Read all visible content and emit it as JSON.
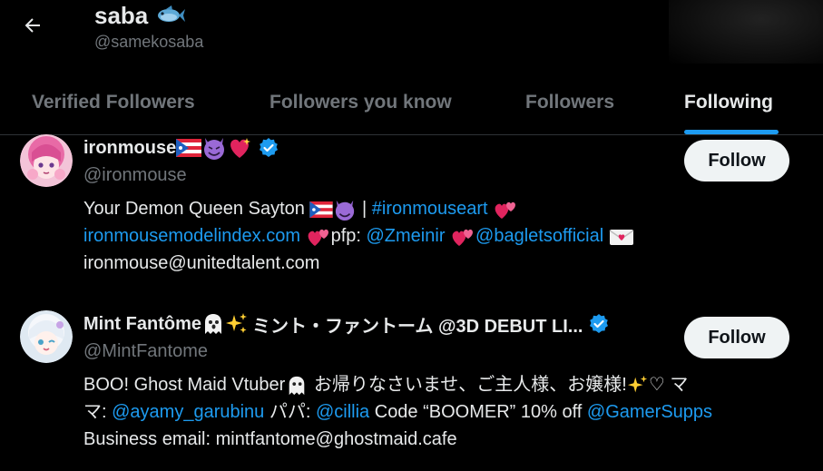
{
  "header": {
    "title": "saba",
    "handle": "@samekosaba",
    "title_icon": "fish-icon"
  },
  "tabs": [
    {
      "label": "Verified Followers",
      "active": false
    },
    {
      "label": "Followers you know",
      "active": false
    },
    {
      "label": "Followers",
      "active": false
    },
    {
      "label": "Following",
      "active": true
    }
  ],
  "users": [
    {
      "name": "ironmouse",
      "name_emojis": [
        "puerto-rico-flag-icon",
        "smiling-devil-icon",
        "sparkling-heart-icon"
      ],
      "verified": true,
      "handle": "@ironmouse",
      "follow_label": "Follow",
      "bio": {
        "line1_a": "Your Demon Queen Sayton ",
        "line1_b": " | ",
        "line1_link": "#ironmouseart",
        "line2_link1": "ironmousemodelindex.com",
        "line2_text": "pfp: ",
        "line2_link2": "@Zmeinir",
        "line2_link3": "@bagletsofficial",
        "line3": "ironmouse@unitedtalent.com"
      }
    },
    {
      "name_a": "Mint Fantôme",
      "name_b": "ミント・ファントーム @3D DEBUT LI...",
      "verified": true,
      "handle": "@MintFantome",
      "follow_label": "Follow",
      "bio": {
        "line1_a": "BOO! Ghost Maid Vtuber",
        "line1_b": " お帰りなさいませ、ご主人様、お嬢様!",
        "line1_c": "♡ マ",
        "line2_a": "マ: ",
        "line2_link1": "@ayamy_garubinu",
        "line2_b": " パパ: ",
        "line2_link2": "@cillia",
        "line2_c": " Code “BOOMER” 10% off ",
        "line2_link3": "@GamerSupps",
        "line3": "Business email: mintfantome@ghostmaid.cafe"
      }
    }
  ],
  "colors": {
    "accent": "#1d9bf0",
    "muted": "#71767b",
    "text": "#e7e9ea",
    "button_bg": "#eff3f4"
  }
}
